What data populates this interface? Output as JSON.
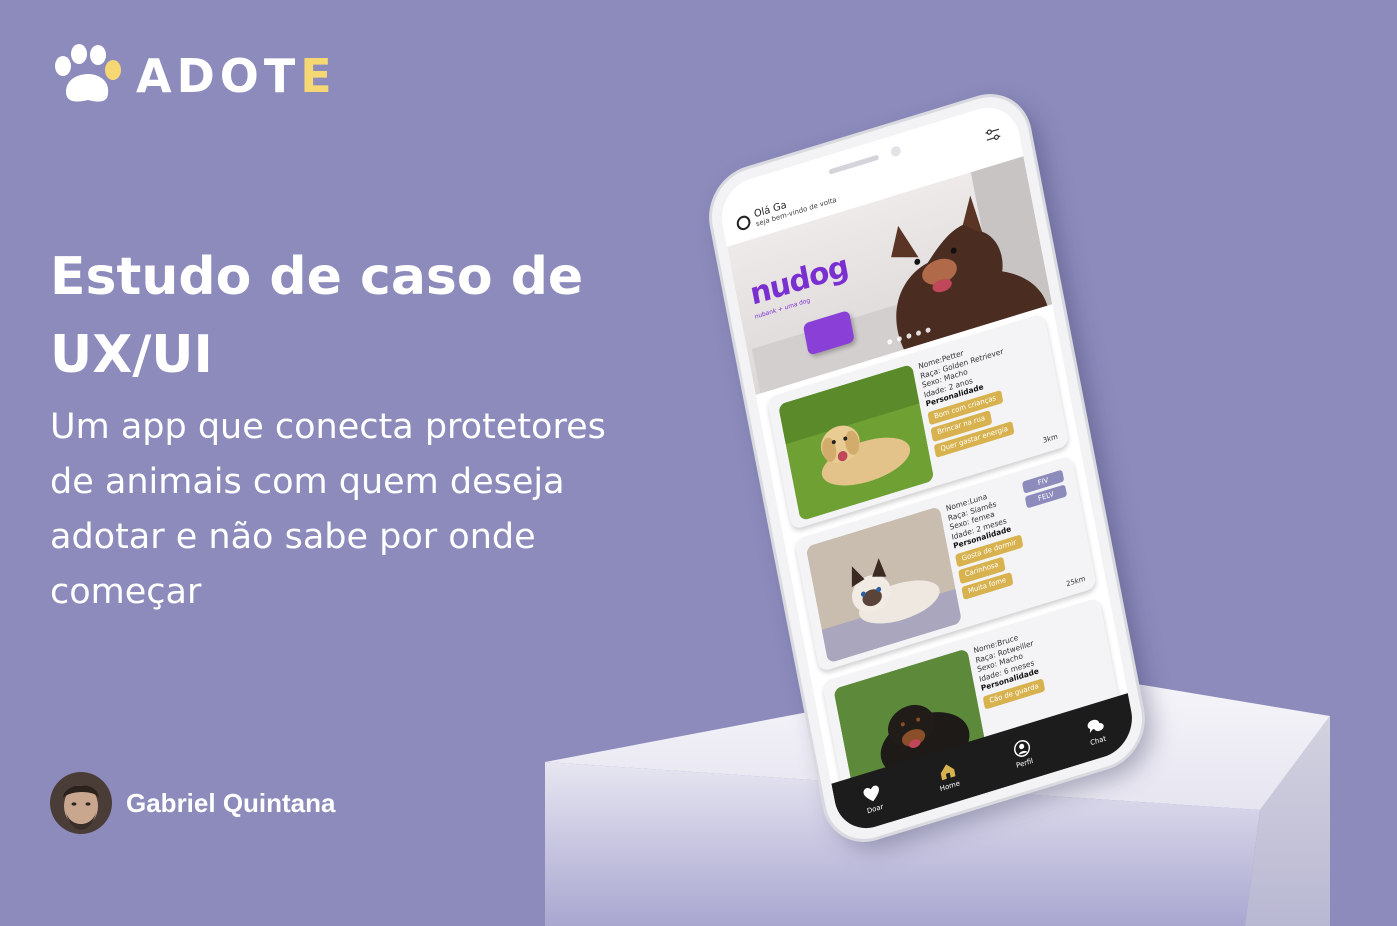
{
  "brand": {
    "name_main": "ADOT",
    "name_last": "E",
    "accent": "#f5d774",
    "background": "#8c8bbc"
  },
  "headline": "Estudo de caso de UX/UI",
  "subline": "Um app que conecta protetores de animais com quem deseja adotar e não sabe por onde começar",
  "author": {
    "name": "Gabriel Quintana"
  },
  "app": {
    "greeting": "Olá Ga",
    "greeting_sub": "seja bem-vindo de volta",
    "banner": {
      "brand": "nudog",
      "brand_sub": "nubank + uma dog"
    },
    "pets": [
      {
        "name": "Nome:Petter",
        "breed": "Raça: Golden Retriever",
        "sex": "Sexo: Macho",
        "age": "Idade: 2 anos",
        "personality_label": "Personalidade",
        "tags": [
          "Bom com crianças",
          "Brincar na rua",
          "Quer gastar energia"
        ],
        "distance": "3km"
      },
      {
        "name": "Nome:Luna",
        "breed": "Raça: Siamês",
        "sex": "Sexo: femea",
        "age": "Idade: 2 meses",
        "personality_label": "Personalidade",
        "tags": [
          "Gosta de dormir",
          "Carinhosa",
          "Muita fome"
        ],
        "health_tags": [
          "FIV",
          "FELV"
        ],
        "distance": "25km"
      },
      {
        "name": "Nome:Bruce",
        "breed": "Raça: Rotweiller",
        "sex": "Sexo: Macho",
        "age": "Idade: 6 meses",
        "personality_label": "Personalidade",
        "tags": [
          "Cão de guarda"
        ],
        "distance": ""
      }
    ],
    "tabs": [
      {
        "label": "Doar",
        "icon": "heart-icon"
      },
      {
        "label": "Home",
        "icon": "home-icon"
      },
      {
        "label": "Perfil",
        "icon": "user-icon"
      },
      {
        "label": "Chat",
        "icon": "chat-icon"
      }
    ]
  }
}
